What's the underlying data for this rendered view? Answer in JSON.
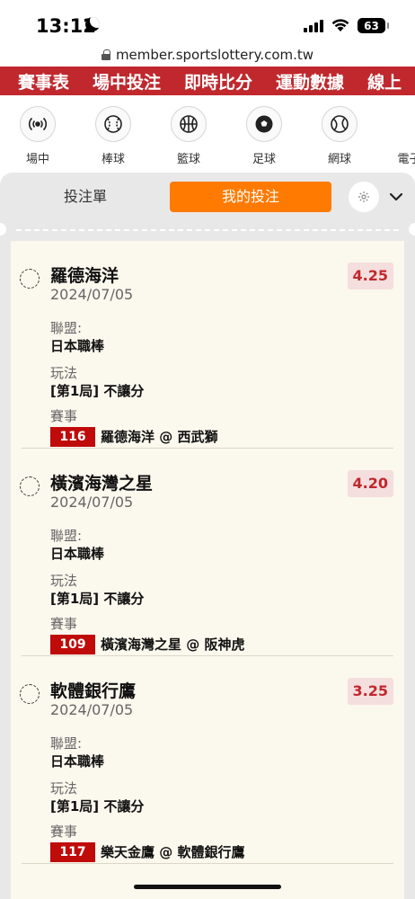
{
  "status_bar": {
    "time": "13:12",
    "battery": "63"
  },
  "browser": {
    "url": "member.sportslottery.com.tw"
  },
  "top_nav": {
    "items": [
      "賽事表",
      "場中投注",
      "即時比分",
      "運動數據",
      "線上"
    ]
  },
  "sports": [
    {
      "label": "場中",
      "icon": "live-signal-icon"
    },
    {
      "label": "棒球",
      "icon": "baseball-icon"
    },
    {
      "label": "籃球",
      "icon": "basketball-icon"
    },
    {
      "label": "足球",
      "icon": "soccer-icon"
    },
    {
      "label": "網球",
      "icon": "tennis-icon"
    },
    {
      "label": "電子競",
      "icon": "esports-icon"
    }
  ],
  "tabs": {
    "bet_slip": "投注單",
    "my_bets": "我的投注"
  },
  "labels": {
    "league": "聯盟:",
    "market": "玩法",
    "event": "賽事"
  },
  "bets": [
    {
      "team": "羅德海洋",
      "date": "2024/07/05",
      "odds": "4.25",
      "league": "日本職棒",
      "market": "[第1局] 不讓分",
      "match_id": "116",
      "match": "羅德海洋 @ 西武獅"
    },
    {
      "team": "橫濱海灣之星",
      "date": "2024/07/05",
      "odds": "4.20",
      "league": "日本職棒",
      "market": "[第1局] 不讓分",
      "match_id": "109",
      "match": "橫濱海灣之星 @ 阪神虎"
    },
    {
      "team": "軟體銀行鷹",
      "date": "2024/07/05",
      "odds": "3.25",
      "league": "日本職棒",
      "market": "[第1局] 不讓分",
      "match_id": "117",
      "match": "樂天金鷹 @ 軟體銀行鷹"
    }
  ],
  "colors": {
    "brand_red": "#c0282d",
    "accent_orange": "#ff7a00",
    "match_badge": "#c00b0b",
    "ticket_bg": "#fbf8ee"
  }
}
